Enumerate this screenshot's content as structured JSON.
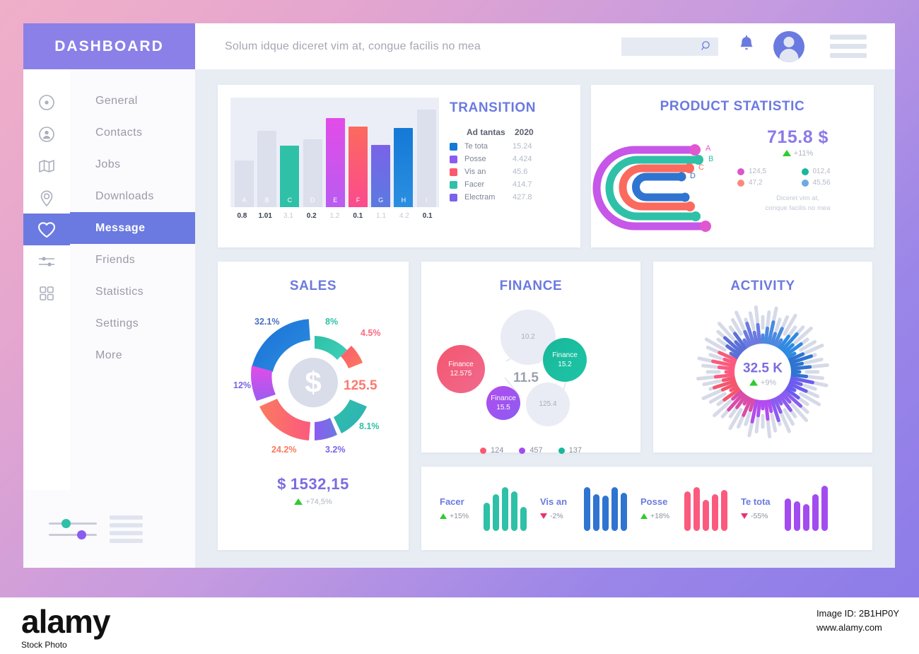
{
  "brand": {
    "title": "DASHBOARD"
  },
  "sidebar": {
    "rail_icons": [
      "target-icon",
      "user-circle-icon",
      "map-icon",
      "location-pin-icon",
      "heart-icon",
      "sliders-icon",
      "grid-icon"
    ],
    "items": [
      {
        "label": "General",
        "active": false
      },
      {
        "label": "Contacts",
        "active": false
      },
      {
        "label": "Jobs",
        "active": false
      },
      {
        "label": "Downloads",
        "active": false
      },
      {
        "label": "Message",
        "active": true
      },
      {
        "label": "Friends",
        "active": false
      },
      {
        "label": "Statistics",
        "active": false
      },
      {
        "label": "Settings",
        "active": false
      },
      {
        "label": "More",
        "active": false
      }
    ],
    "footer": {
      "slider_one_color": "#2fc0a8",
      "slider_two_color": "#8b5cf0"
    }
  },
  "topbar": {
    "title": "Solum idque diceret vim at, congue facilis no mea",
    "search_placeholder": "",
    "search_value": "",
    "icons": [
      "search-icon",
      "bell-icon",
      "avatar",
      "hamburger-icon"
    ]
  },
  "transition": {
    "title": "TRANSITION",
    "header": {
      "name": "Ad tantas",
      "year": "2020"
    },
    "legend": [
      {
        "name": "Te tota",
        "value": "15.24",
        "color": "#1479d6"
      },
      {
        "name": "Posse",
        "value": "4.424",
        "color": "#8b5cf0"
      },
      {
        "name": "Vis an",
        "value": "45.6",
        "color": "#fb5a6e"
      },
      {
        "name": "Facer",
        "value": "414.7",
        "color": "#2fc0a8"
      },
      {
        "name": "Electram",
        "value": "427.8",
        "color": "#7a63e8"
      }
    ],
    "chart_data": {
      "type": "bar",
      "title": "TRANSITION",
      "xlabel": "",
      "ylabel": "",
      "categories": [
        "A",
        "B",
        "C",
        "D",
        "E",
        "F",
        "G",
        "H",
        "I"
      ],
      "tick_labels": [
        "0.8",
        "1.01",
        "3.1",
        "0.2",
        "1.2",
        "0.1",
        "1.1",
        "4.2",
        "0.1"
      ],
      "values": [
        44,
        72,
        58,
        64,
        84,
        76,
        59,
        75,
        92
      ],
      "ylim": [
        0,
        100
      ],
      "grid": false,
      "colors": [
        "#dcdfec",
        "#dcdfec",
        "#2fc0a8",
        "#dcdfec",
        "#d957f0",
        "#fb5a6e",
        "#7a63e8",
        "#1479d6",
        "#dcdfec"
      ],
      "highlighted": [
        "C",
        "E",
        "F",
        "G",
        "H"
      ]
    }
  },
  "product": {
    "title": "PRODUCT STATISTIC",
    "value": "715.8 $",
    "delta": "+11%",
    "delta_dir": "up",
    "arc_labels": [
      "A",
      "B",
      "C",
      "D"
    ],
    "stats": [
      {
        "value": "124,5",
        "color": "#d957c9"
      },
      {
        "value": "012,4",
        "color": "#18b89a"
      },
      {
        "value": "47,2",
        "color": "#fb8a7e"
      },
      {
        "value": "45,56",
        "color": "#6ea9e8"
      }
    ],
    "note": "Diceret vim at,\nconque facilis no mea",
    "chart_data": {
      "type": "line",
      "title": "PRODUCT STATISTIC",
      "series": [
        {
          "name": "A",
          "color": "#c657e8",
          "value": "124,5"
        },
        {
          "name": "B",
          "color": "#2fc0a8",
          "value": "012,4"
        },
        {
          "name": "C",
          "color": "#fb6a5e",
          "value": "47,2"
        },
        {
          "name": "D",
          "color": "#2f74d0",
          "value": "45,56"
        }
      ]
    }
  },
  "sales": {
    "title": "SALES",
    "center_label": "$",
    "side_value": "125.5",
    "amount_currency": "$",
    "amount": "1532,15",
    "delta": "+74,5%",
    "delta_dir": "up",
    "chart_data": {
      "type": "pie",
      "title": "SALES",
      "labels": [
        "8%",
        "4.5%",
        "8.1%",
        "3.2%",
        "24.2%",
        "12%",
        "32.1%"
      ],
      "values": [
        8,
        4.5,
        8.1,
        3.2,
        24.2,
        12,
        32.1
      ],
      "colors": [
        "#2fc0a8",
        "#fb5a6e",
        "#2fc0a8",
        "#7a63e8",
        "#fb6a5e",
        "#c657e8",
        "#1479d6"
      ],
      "label_colors": [
        "#2fc0a8",
        "#fb5a6e",
        "#2fc0a8",
        "#7a63e8",
        "#fb6a5e",
        "#7a63e8",
        "#4a6fc0"
      ]
    }
  },
  "finance": {
    "title": "FINANCE",
    "center": "11.5",
    "bubbles": [
      {
        "label": "",
        "value": "10.2",
        "color": "#e9ecf4",
        "ghost": true
      },
      {
        "label": "Finance",
        "value": "12.575",
        "color": "#f45a78",
        "ghost": false
      },
      {
        "label": "Finance",
        "value": "15.2",
        "color": "#18b89a",
        "ghost": false
      },
      {
        "label": "Finance",
        "value": "15.5",
        "color": "#a24cf0",
        "ghost": false
      },
      {
        "label": "",
        "value": "125.4",
        "color": "#e9ecf4",
        "ghost": true
      }
    ],
    "legend": [
      {
        "value": "124",
        "color": "#fb5a6e"
      },
      {
        "value": "457",
        "color": "#a24cf0"
      },
      {
        "value": "137",
        "color": "#18b89a"
      }
    ],
    "chart_data": {
      "type": "scatter",
      "title": "FINANCE",
      "center_value": 11.5,
      "points": [
        {
          "name": "",
          "value": 10.2,
          "r": 46
        },
        {
          "name": "Finance",
          "value": 12.575,
          "r": 38
        },
        {
          "name": "Finance",
          "value": 15.2,
          "r": 42
        },
        {
          "name": "Finance",
          "value": 15.5,
          "r": 33
        },
        {
          "name": "",
          "value": 125.4,
          "r": 40
        }
      ]
    }
  },
  "activity": {
    "title": "ACTIVITY",
    "value": "32.5 K",
    "delta": "+9%",
    "delta_dir": "up",
    "chart_data": {
      "type": "bar",
      "title": "ACTIVITY",
      "subtype": "radial",
      "center_value": "32.5 K",
      "n_spokes": 60
    }
  },
  "strip": {
    "stats": [
      {
        "name": "Facer",
        "delta": "+15%",
        "dir": "up",
        "color": "#2fc0a8",
        "bars": [
          40,
          52,
          62,
          56,
          34
        ]
      },
      {
        "name": "Vis an",
        "delta": "-2%",
        "dir": "down",
        "color": "#2f74d0",
        "bars": [
          62,
          52,
          50,
          62,
          54
        ]
      },
      {
        "name": "Posse",
        "delta": "+18%",
        "dir": "up",
        "color": "#fb5a7e",
        "bars": [
          56,
          62,
          44,
          52,
          58
        ]
      },
      {
        "name": "Te tota",
        "delta": "-55%",
        "dir": "down",
        "color": "#a24cf0",
        "bars": [
          46,
          42,
          38,
          52,
          64
        ]
      }
    ],
    "chart_data": {
      "type": "bar",
      "series": [
        {
          "name": "Facer",
          "values": [
            40,
            52,
            62,
            56,
            34
          ]
        },
        {
          "name": "Vis an",
          "values": [
            62,
            52,
            50,
            62,
            54
          ]
        },
        {
          "name": "Posse",
          "values": [
            56,
            62,
            44,
            52,
            58
          ]
        },
        {
          "name": "Te tota",
          "values": [
            46,
            42,
            38,
            52,
            64
          ]
        }
      ]
    }
  },
  "footer": {
    "logo": "alamy",
    "image_id": "Image ID: 2B1HP0Y",
    "url": "www.alamy.com",
    "copy": "Stock Photo"
  }
}
